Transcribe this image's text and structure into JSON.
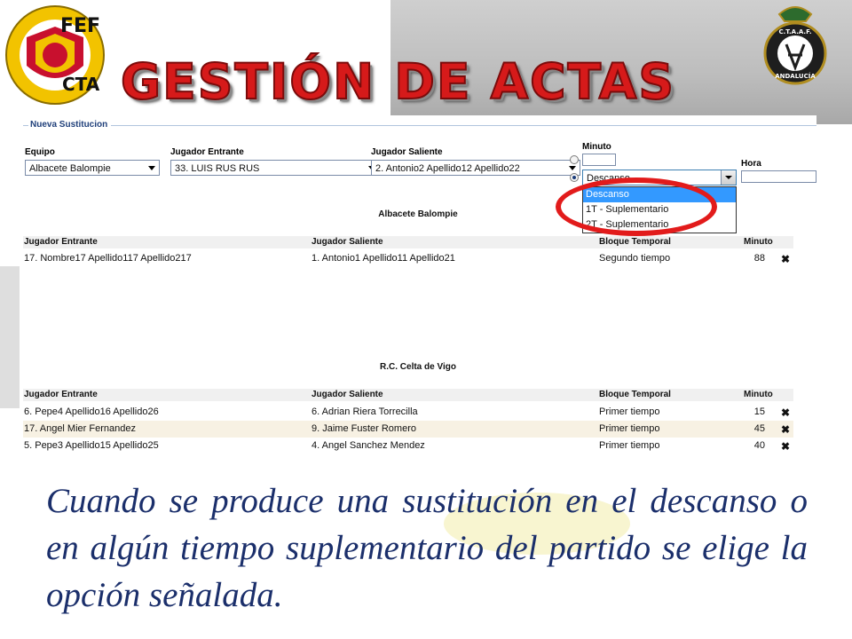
{
  "header": {
    "title": "GESTIÓN DE ACTAS",
    "left_logo": {
      "text_top": "FEF",
      "text_bottom": "CTA",
      "ring_text": "REAL FEDERACIÓN ESPAÑOLA DE FÚTBOL",
      "icon": "rfef-shield-logo"
    },
    "right_logo": {
      "text_top": "C.T.A.A.F.",
      "text_bottom": "ANDALUCÍA",
      "icon": "ctaaf-crest-logo"
    }
  },
  "form": {
    "legend": "Nueva Sustitucion",
    "equipo_label": "Equipo",
    "equipo_value": "Albacete Balompie",
    "entrante_label": "Jugador Entrante",
    "entrante_value": "33. LUIS RUS RUS",
    "saliente_label": "Jugador Saliente",
    "saliente_value": "2. Antonio2 Apellido12 Apellido22",
    "minuto_label": "Minuto",
    "minuto_value": "",
    "bloque_value": "Descanso",
    "bloque_options": [
      "Descanso",
      "1T - Suplementario",
      "2T - Suplementario"
    ],
    "hora_label": "Hora",
    "hora_value": ""
  },
  "tables": [
    {
      "team": "Albacete Balompie",
      "headers": [
        "Jugador Entrante",
        "Jugador Saliente",
        "Bloque Temporal",
        "Minuto"
      ],
      "rows": [
        {
          "entrante": "17. Nombre17 Apellido117 Apellido217",
          "saliente": "1. Antonio1 Apellido11 Apellido21",
          "bloque": "Segundo tiempo",
          "minuto": "88"
        }
      ]
    },
    {
      "team": "R.C. Celta de Vigo",
      "headers": [
        "Jugador Entrante",
        "Jugador Saliente",
        "Bloque Temporal",
        "Minuto"
      ],
      "rows": [
        {
          "entrante": "6. Pepe4 Apellido16 Apellido26",
          "saliente": "6. Adrian Riera Torrecilla",
          "bloque": "Primer tiempo",
          "minuto": "15"
        },
        {
          "entrante": "17. Angel Mier Fernandez",
          "saliente": "9. Jaime Fuster Romero",
          "bloque": "Primer tiempo",
          "minuto": "45"
        },
        {
          "entrante": "5. Pepe3 Apellido15 Apellido25",
          "saliente": "4. Angel Sanchez Mendez",
          "bloque": "Primer tiempo",
          "minuto": "40"
        }
      ]
    }
  ],
  "delete_glyph": "✖",
  "caption": "Cuando se produce una sustitución en el descanso o en algún tiempo suplementario del partido se elige la opción señalada.",
  "colors": {
    "title_red": "#d61a1a",
    "caption_blue": "#1b2f6b",
    "highlight_red": "#e21b1b",
    "selected_option": "#3399ff"
  }
}
